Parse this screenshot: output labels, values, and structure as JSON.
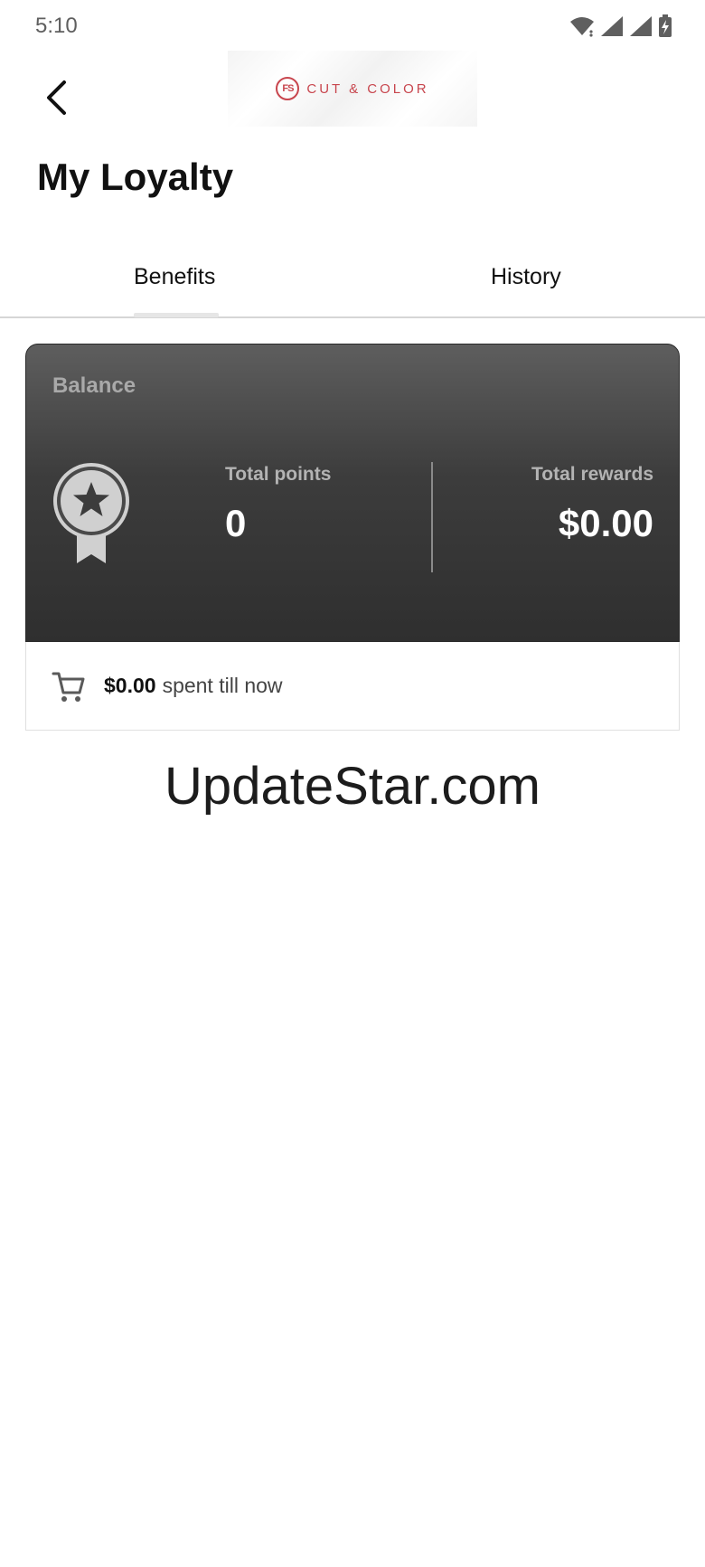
{
  "status_bar": {
    "time": "5:10",
    "icons": [
      "wifi-icon",
      "signal-icon",
      "signal-icon",
      "battery-charging-icon"
    ]
  },
  "header": {
    "back_icon": "chevron-left-icon",
    "logo": {
      "mark": "FS",
      "text": "CUT & COLOR",
      "color": "#c8464e"
    }
  },
  "page": {
    "title": "My Loyalty"
  },
  "tabs": [
    {
      "label": "Benefits",
      "selected": true
    },
    {
      "label": "History",
      "selected": false
    }
  ],
  "balance_card": {
    "label": "Balance",
    "icon": "award-medal-icon",
    "total_points": {
      "label": "Total points",
      "value": "0"
    },
    "total_rewards": {
      "label": "Total rewards",
      "value": "$0.00"
    }
  },
  "spent": {
    "icon": "shopping-cart-icon",
    "amount": "$0.00",
    "text": "spent till now"
  },
  "watermark": "UpdateStar.com"
}
